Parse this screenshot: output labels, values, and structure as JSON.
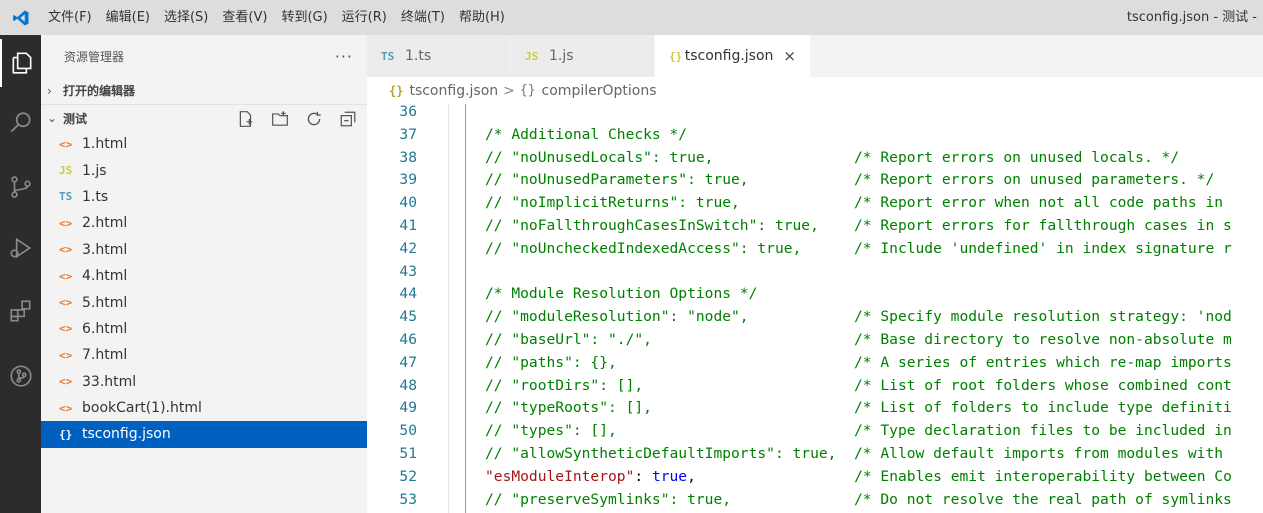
{
  "menu": [
    "文件(F)",
    "编辑(E)",
    "选择(S)",
    "查看(V)",
    "转到(G)",
    "运行(R)",
    "终端(T)",
    "帮助(H)"
  ],
  "window_title": "tsconfig.json - 测试 -",
  "colors": {
    "accent": "#0060c0",
    "activity_bar": "#2c2c2c",
    "logo": "#0078d4"
  },
  "activity_icons": [
    "explorer-icon",
    "search-icon",
    "source-control-icon",
    "run-debug-icon",
    "extensions-icon",
    "git-graph-icon"
  ],
  "sidebar": {
    "title": "资源管理器",
    "more": "···",
    "open_editors": "打开的编辑器",
    "folder": "测试",
    "folder_actions": [
      "new-file-icon",
      "new-folder-icon",
      "refresh-icon",
      "collapse-all-icon"
    ],
    "files": [
      {
        "icon": "<>",
        "type": "html",
        "name": "1.html"
      },
      {
        "icon": "JS",
        "type": "js",
        "name": "1.js"
      },
      {
        "icon": "TS",
        "type": "ts",
        "name": "1.ts"
      },
      {
        "icon": "<>",
        "type": "html",
        "name": "2.html"
      },
      {
        "icon": "<>",
        "type": "html",
        "name": "3.html"
      },
      {
        "icon": "<>",
        "type": "html",
        "name": "4.html"
      },
      {
        "icon": "<>",
        "type": "html",
        "name": "5.html"
      },
      {
        "icon": "<>",
        "type": "html",
        "name": "6.html"
      },
      {
        "icon": "<>",
        "type": "html",
        "name": "7.html"
      },
      {
        "icon": "<>",
        "type": "html",
        "name": "33.html"
      },
      {
        "icon": "<>",
        "type": "html",
        "name": "bookCart(1).html"
      },
      {
        "icon": "{}",
        "type": "json",
        "name": "tsconfig.json",
        "selected": true
      }
    ]
  },
  "tabs": [
    {
      "icon": "TS",
      "type": "ts",
      "label": "1.ts",
      "active": false
    },
    {
      "icon": "JS",
      "type": "js",
      "label": "1.js",
      "active": false
    },
    {
      "icon": "{}",
      "type": "json",
      "label": "tsconfig.json",
      "active": true,
      "close": "×"
    }
  ],
  "breadcrumb": {
    "file_icon": "{}",
    "file": "tsconfig.json",
    "separator": ">",
    "symbol_icon": "{}",
    "symbol": "compilerOptions"
  },
  "code_lines": [
    {
      "n": "36",
      "text": "",
      "kind": "comment"
    },
    {
      "n": "37",
      "text": "/* Additional Checks */",
      "kind": "comment"
    },
    {
      "n": "38",
      "text": "// \"noUnusedLocals\": true,                /* Report errors on unused locals. */",
      "kind": "comment"
    },
    {
      "n": "39",
      "text": "// \"noUnusedParameters\": true,            /* Report errors on unused parameters. */",
      "kind": "comment"
    },
    {
      "n": "40",
      "text": "// \"noImplicitReturns\": true,             /* Report error when not all code paths in",
      "kind": "comment"
    },
    {
      "n": "41",
      "text": "// \"noFallthroughCasesInSwitch\": true,    /* Report errors for fallthrough cases in s",
      "kind": "comment"
    },
    {
      "n": "42",
      "text": "// \"noUncheckedIndexedAccess\": true,      /* Include 'undefined' in index signature r",
      "kind": "comment"
    },
    {
      "n": "43",
      "text": "",
      "kind": "comment"
    },
    {
      "n": "44",
      "text": "/* Module Resolution Options */",
      "kind": "comment"
    },
    {
      "n": "45",
      "text": "// \"moduleResolution\": \"node\",            /* Specify module resolution strategy: 'nod",
      "kind": "comment"
    },
    {
      "n": "46",
      "text": "// \"baseUrl\": \"./\",                       /* Base directory to resolve non-absolute m",
      "kind": "comment"
    },
    {
      "n": "47",
      "text": "// \"paths\": {},                           /* A series of entries which re-map imports",
      "kind": "comment"
    },
    {
      "n": "48",
      "text": "// \"rootDirs\": [],                        /* List of root folders whose combined cont",
      "kind": "comment"
    },
    {
      "n": "49",
      "text": "// \"typeRoots\": [],                       /* List of folders to include type definiti",
      "kind": "comment"
    },
    {
      "n": "50",
      "text": "// \"types\": [],                           /* Type declaration files to be included in",
      "kind": "comment"
    },
    {
      "n": "51",
      "text": "// \"allowSyntheticDefaultImports\": true,  /* Allow default imports from modules with",
      "kind": "comment"
    },
    {
      "n": "52",
      "prop": "\"esModuleInterop\"",
      "colon": ": ",
      "value": "true",
      "comma": ",",
      "pad": "                  ",
      "comment": "/* Enables emit interoperability between Co",
      "kind": "active"
    },
    {
      "n": "53",
      "text": "// \"preserveSymlinks\": true,              /* Do not resolve the real path of symlinks",
      "kind": "comment"
    }
  ]
}
